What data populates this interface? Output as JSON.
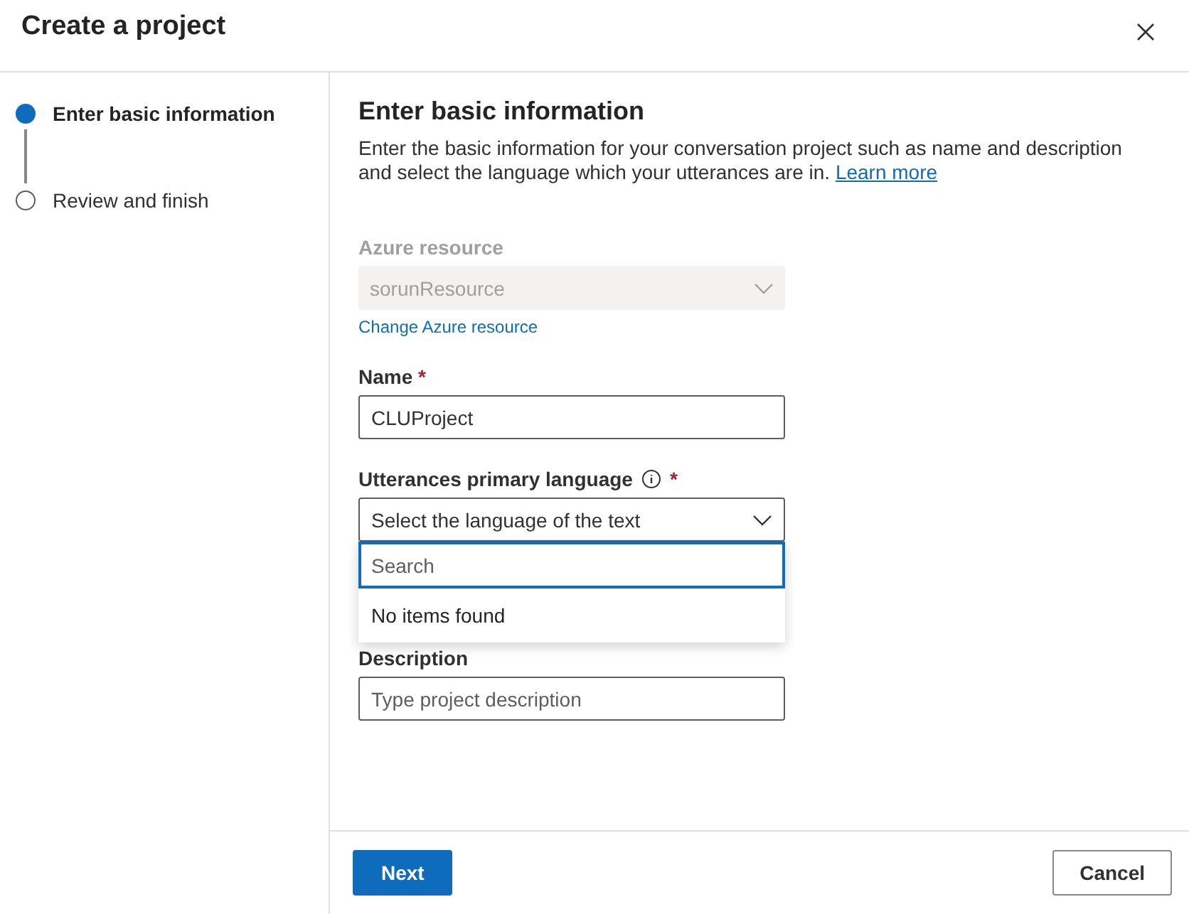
{
  "dialog": {
    "title": "Create a project"
  },
  "steps": [
    {
      "label": "Enter basic information",
      "selected": true
    },
    {
      "label": "Review and finish",
      "selected": false
    }
  ],
  "section": {
    "heading": "Enter basic information",
    "description": "Enter the basic information for your conversation project such as name and description and select the language which your utterances are in.",
    "link": "Learn more"
  },
  "azure_resource": {
    "label": "Azure resource",
    "value": "sorunResource",
    "disabled": true,
    "link": "Change Azure resource"
  },
  "name": {
    "label": "Name",
    "required_mark": "*",
    "value": "CLUProject"
  },
  "language": {
    "label": "Utterances primary language",
    "required_mark": "*",
    "placeholder": "Select the language of the text",
    "expanded": true,
    "search_placeholder": "Search",
    "empty_message": "No items found"
  },
  "description": {
    "label": "Description",
    "placeholder": "Type project description"
  },
  "buttons": [
    {
      "label": "Next",
      "kind": "primary"
    },
    {
      "label": "Cancel",
      "kind": "secondary"
    }
  ]
}
